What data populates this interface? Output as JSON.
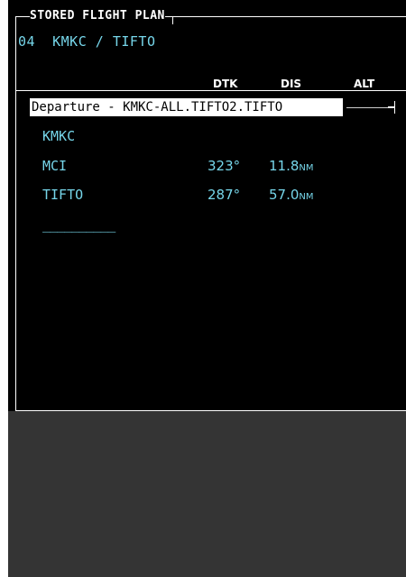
{
  "window_title": "STORED FLIGHT PLAN",
  "plan": {
    "number": "04",
    "route": "KMKC / TIFTO"
  },
  "columns": {
    "dtk": "DTK",
    "dis": "DIS",
    "alt": "ALT"
  },
  "departure_label": "Departure - KMKC-ALL.TIFTO2.TIFTO",
  "waypoints": [
    {
      "name": "KMKC",
      "dtk": "",
      "dis": "",
      "unit": ""
    },
    {
      "name": "MCI",
      "dtk": "323°",
      "dis": "11.8",
      "unit": "NM"
    },
    {
      "name": "TIFTO",
      "dtk": "287°",
      "dis": "57.0",
      "unit": "NM"
    }
  ],
  "empty_entry": "__________",
  "colors": {
    "cyan": "#76d6ea",
    "background": "#000000",
    "panel": "#343434"
  }
}
